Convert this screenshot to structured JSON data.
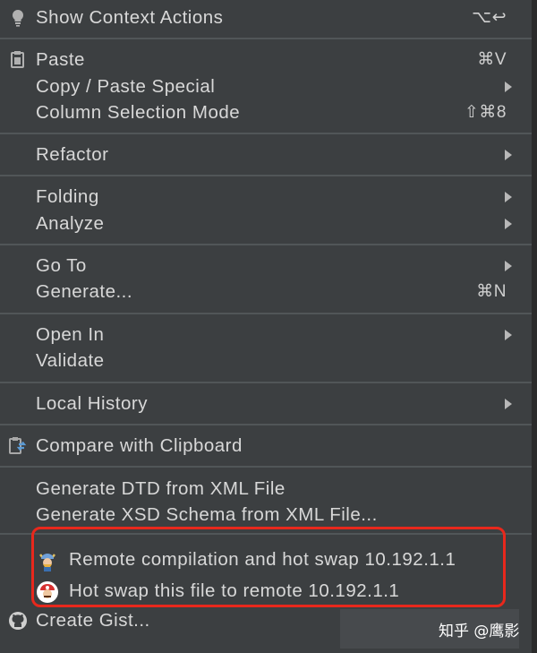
{
  "menu": {
    "items": [
      {
        "label": "Show Context Actions",
        "shortcut": "⌥↩",
        "icon": "lightbulb-icon"
      },
      {
        "label": "Paste",
        "shortcut": "⌘V",
        "icon": "clipboard-icon"
      },
      {
        "label": "Copy / Paste Special",
        "submenu": true
      },
      {
        "label": "Column Selection Mode",
        "shortcut": "⇧⌘8"
      },
      {
        "label": "Refactor",
        "submenu": true
      },
      {
        "label": "Folding",
        "submenu": true
      },
      {
        "label": "Analyze",
        "submenu": true
      },
      {
        "label": "Go To",
        "submenu": true
      },
      {
        "label": "Generate...",
        "shortcut": "⌘N"
      },
      {
        "label": "Open In",
        "submenu": true
      },
      {
        "label": "Validate"
      },
      {
        "label": "Local History",
        "submenu": true
      },
      {
        "label": "Compare with Clipboard",
        "icon": "compare-clipboard-icon"
      },
      {
        "label": "Generate DTD from XML File"
      },
      {
        "label": "Generate XSD Schema from XML File..."
      },
      {
        "label": "Remote compilation and hot swap 10.192.1.1",
        "icon": "viking-avatar-icon"
      },
      {
        "label": "Hot swap this file to remote 10.192.1.1",
        "icon": "mario-avatar-icon"
      },
      {
        "label": "Create Gist...",
        "icon": "github-icon"
      }
    ]
  },
  "watermark": "知乎 @鹰影",
  "colors": {
    "menu_bg": "#3c3f41",
    "separator": "#515658",
    "highlight_border": "#e8281c"
  }
}
